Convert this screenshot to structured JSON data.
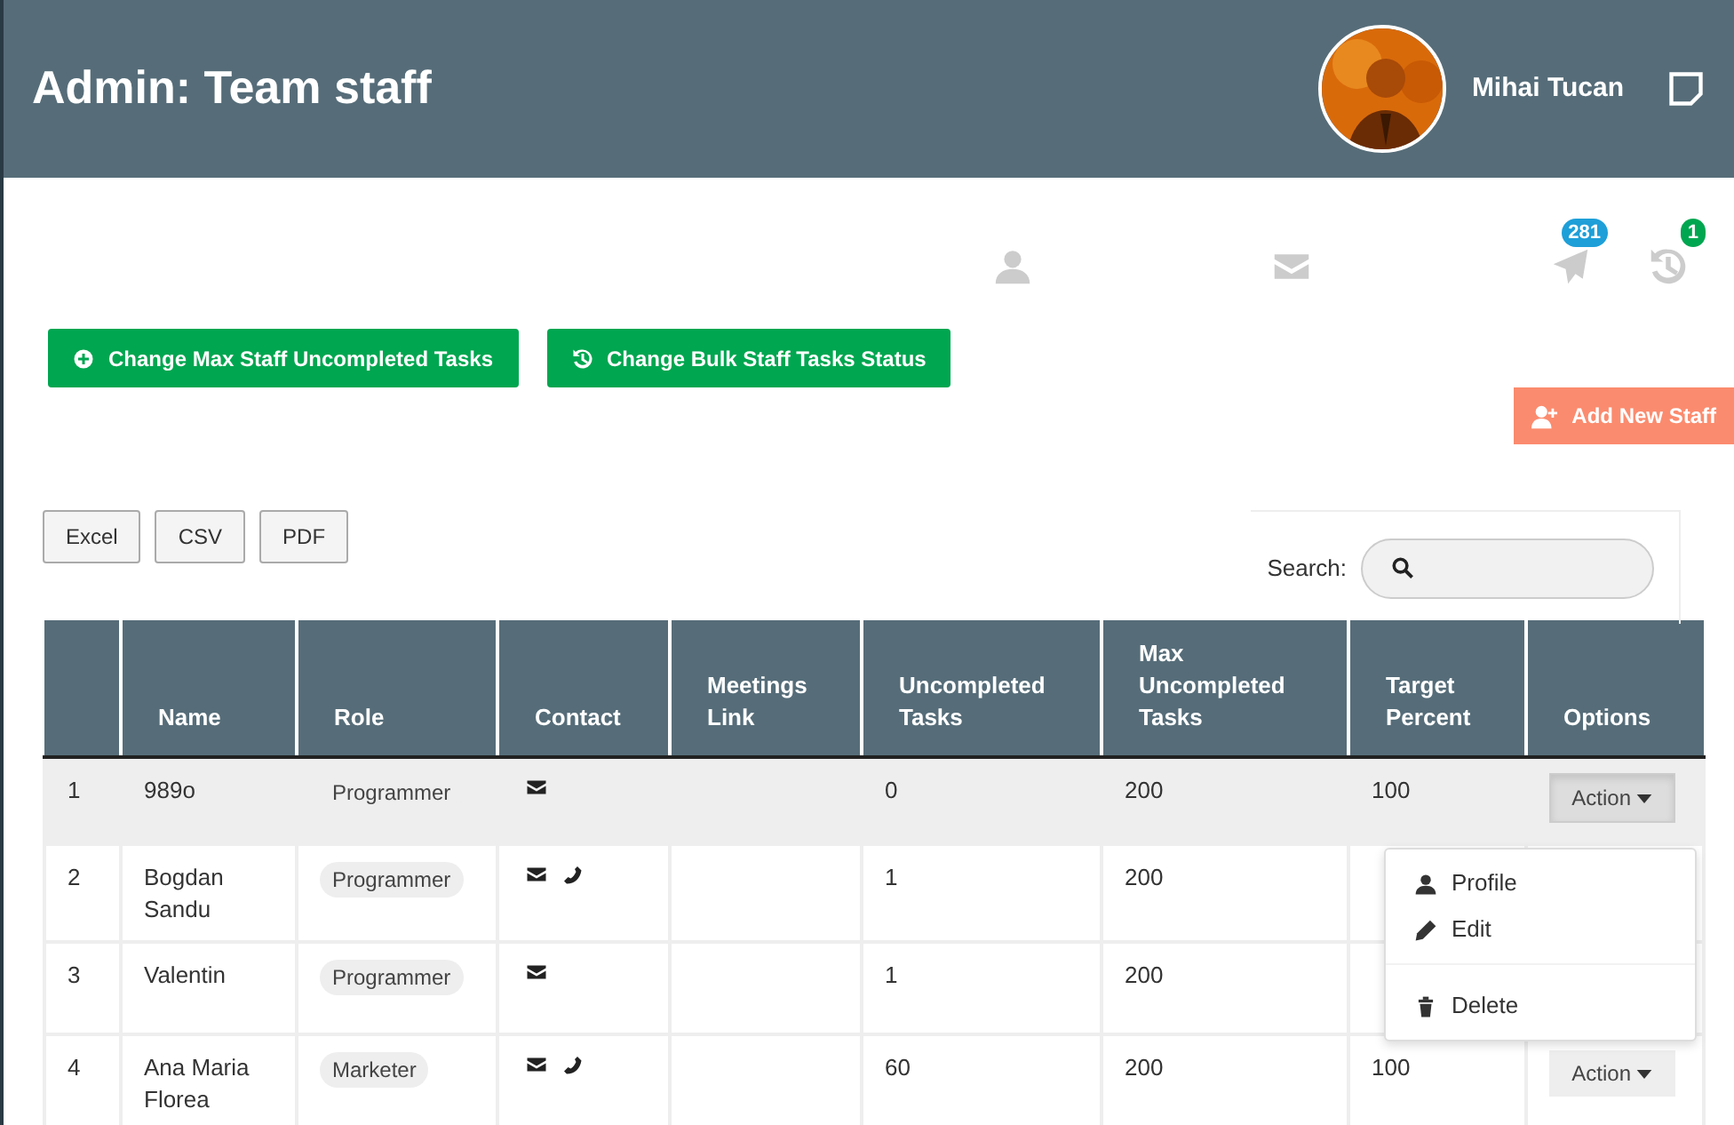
{
  "header": {
    "title": "Admin: Team staff",
    "user_name": "Mihai Tucan"
  },
  "nav_icons": [
    {
      "kind": "user"
    },
    {
      "kind": "mail"
    },
    {
      "kind": "send",
      "badge": "281",
      "color": "#1e9fd8"
    },
    {
      "kind": "history",
      "badge": "1",
      "color": "#00a650"
    }
  ],
  "actions": [
    {
      "kind": "plus",
      "label": "Change Max Staff Uncompleted Tasks"
    },
    {
      "kind": "history",
      "label": "Change Bulk Staff Tasks Status"
    }
  ],
  "add_button": {
    "label": "Add New Staff"
  },
  "export_buttons": [
    "Excel",
    "CSV",
    "PDF"
  ],
  "search": {
    "label": "Search:"
  },
  "table": {
    "columns": [
      "",
      "Name",
      "Role",
      "Contact",
      "Meetings Link",
      "Uncompleted Tasks",
      "Max Uncompleted Tasks",
      "Target Percent",
      "Options"
    ],
    "rows": [
      {
        "index": "1",
        "name": "989o",
        "role": "Programmer",
        "contact": [
          {
            "kind": "mail"
          }
        ],
        "uncompleted": "0",
        "max": "200",
        "target": "100",
        "action": "Action",
        "selected": true,
        "menu_open": true
      },
      {
        "index": "2",
        "name": "Bogdan Sandu",
        "role": "Programmer",
        "contact": [
          {
            "kind": "mail"
          },
          {
            "kind": "phone"
          }
        ],
        "uncompleted": "1",
        "max": "200",
        "selected": false,
        "menu_open": false
      },
      {
        "index": "3",
        "name": "Valentin",
        "role": "Programmer",
        "contact": [
          {
            "kind": "mail"
          }
        ],
        "uncompleted": "1",
        "max": "200",
        "selected": false,
        "menu_open": false
      },
      {
        "index": "4",
        "name": "Ana Maria Florea",
        "role": "Marketer",
        "contact": [
          {
            "kind": "mail"
          },
          {
            "kind": "phone"
          }
        ],
        "uncompleted": "60",
        "max": "200",
        "target": "100",
        "action": "Action",
        "selected": false,
        "menu_open": false
      }
    ]
  },
  "dropdown": {
    "items": [
      {
        "kind": "user",
        "label": "Profile"
      },
      {
        "kind": "edit",
        "label": "Edit"
      },
      {
        "kind": "divider"
      },
      {
        "kind": "delete",
        "label": "Delete"
      }
    ]
  }
}
